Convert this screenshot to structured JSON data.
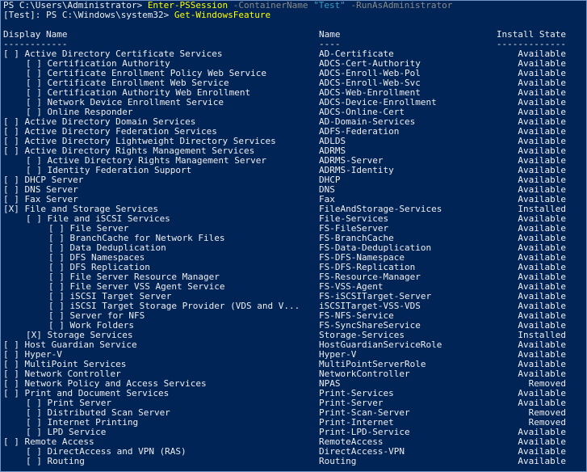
{
  "commands": [
    {
      "prompt": "PS C:\\Users\\Administrator> ",
      "cmdlet": "Enter-PSSession",
      "param1": " -ContainerName ",
      "value1": "\"Test\"",
      "param2": " -RunAsAdministrator"
    },
    {
      "prompt": "[Test]: PS C:\\Windows\\system32> ",
      "cmdlet": "Get-WindowsFeature"
    }
  ],
  "table": {
    "headers": {
      "display": "Display Name",
      "name": "Name",
      "state": "Install State"
    },
    "underline": {
      "display": "------------",
      "name": "----",
      "state": "-------------"
    },
    "rows": [
      {
        "level": 0,
        "display": "[ ] Active Directory Certificate Services",
        "name": "AD-Certificate",
        "state": "Available"
      },
      {
        "level": 1,
        "display": "[ ] Certification Authority",
        "name": "ADCS-Cert-Authority",
        "state": "Available"
      },
      {
        "level": 1,
        "display": "[ ] Certificate Enrollment Policy Web Service",
        "name": "ADCS-Enroll-Web-Pol",
        "state": "Available"
      },
      {
        "level": 1,
        "display": "[ ] Certificate Enrollment Web Service",
        "name": "ADCS-Enroll-Web-Svc",
        "state": "Available"
      },
      {
        "level": 1,
        "display": "[ ] Certification Authority Web Enrollment",
        "name": "ADCS-Web-Enrollment",
        "state": "Available"
      },
      {
        "level": 1,
        "display": "[ ] Network Device Enrollment Service",
        "name": "ADCS-Device-Enrollment",
        "state": "Available"
      },
      {
        "level": 1,
        "display": "[ ] Online Responder",
        "name": "ADCS-Online-Cert",
        "state": "Available"
      },
      {
        "level": 0,
        "display": "[ ] Active Directory Domain Services",
        "name": "AD-Domain-Services",
        "state": "Available"
      },
      {
        "level": 0,
        "display": "[ ] Active Directory Federation Services",
        "name": "ADFS-Federation",
        "state": "Available"
      },
      {
        "level": 0,
        "display": "[ ] Active Directory Lightweight Directory Services",
        "name": "ADLDS",
        "state": "Available"
      },
      {
        "level": 0,
        "display": "[ ] Active Directory Rights Management Services",
        "name": "ADRMS",
        "state": "Available"
      },
      {
        "level": 1,
        "display": "[ ] Active Directory Rights Management Server",
        "name": "ADRMS-Server",
        "state": "Available"
      },
      {
        "level": 1,
        "display": "[ ] Identity Federation Support",
        "name": "ADRMS-Identity",
        "state": "Available"
      },
      {
        "level": 0,
        "display": "[ ] DHCP Server",
        "name": "DHCP",
        "state": "Available"
      },
      {
        "level": 0,
        "display": "[ ] DNS Server",
        "name": "DNS",
        "state": "Available"
      },
      {
        "level": 0,
        "display": "[ ] Fax Server",
        "name": "Fax",
        "state": "Available"
      },
      {
        "level": 0,
        "display": "[X] File and Storage Services",
        "name": "FileAndStorage-Services",
        "state": "Installed"
      },
      {
        "level": 1,
        "display": "[ ] File and iSCSI Services",
        "name": "File-Services",
        "state": "Available"
      },
      {
        "level": 2,
        "display": "[ ] File Server",
        "name": "FS-FileServer",
        "state": "Available"
      },
      {
        "level": 2,
        "display": "[ ] BranchCache for Network Files",
        "name": "FS-BranchCache",
        "state": "Available"
      },
      {
        "level": 2,
        "display": "[ ] Data Deduplication",
        "name": "FS-Data-Deduplication",
        "state": "Available"
      },
      {
        "level": 2,
        "display": "[ ] DFS Namespaces",
        "name": "FS-DFS-Namespace",
        "state": "Available"
      },
      {
        "level": 2,
        "display": "[ ] DFS Replication",
        "name": "FS-DFS-Replication",
        "state": "Available"
      },
      {
        "level": 2,
        "display": "[ ] File Server Resource Manager",
        "name": "FS-Resource-Manager",
        "state": "Available"
      },
      {
        "level": 2,
        "display": "[ ] File Server VSS Agent Service",
        "name": "FS-VSS-Agent",
        "state": "Available"
      },
      {
        "level": 2,
        "display": "[ ] iSCSI Target Server",
        "name": "FS-iSCSITarget-Server",
        "state": "Available"
      },
      {
        "level": 2,
        "display": "[ ] iSCSI Target Storage Provider (VDS and V...",
        "name": "iSCSITarget-VSS-VDS",
        "state": "Available"
      },
      {
        "level": 2,
        "display": "[ ] Server for NFS",
        "name": "FS-NFS-Service",
        "state": "Available"
      },
      {
        "level": 2,
        "display": "[ ] Work Folders",
        "name": "FS-SyncShareService",
        "state": "Available"
      },
      {
        "level": 1,
        "display": "[X] Storage Services",
        "name": "Storage-Services",
        "state": "Installed"
      },
      {
        "level": 0,
        "display": "[ ] Host Guardian Service",
        "name": "HostGuardianServiceRole",
        "state": "Available"
      },
      {
        "level": 0,
        "display": "[ ] Hyper-V",
        "name": "Hyper-V",
        "state": "Available"
      },
      {
        "level": 0,
        "display": "[ ] MultiPoint Services",
        "name": "MultiPointServerRole",
        "state": "Available"
      },
      {
        "level": 0,
        "display": "[ ] Network Controller",
        "name": "NetworkController",
        "state": "Available"
      },
      {
        "level": 0,
        "display": "[ ] Network Policy and Access Services",
        "name": "NPAS",
        "state": "Removed"
      },
      {
        "level": 0,
        "display": "[ ] Print and Document Services",
        "name": "Print-Services",
        "state": "Available"
      },
      {
        "level": 1,
        "display": "[ ] Print Server",
        "name": "Print-Server",
        "state": "Available"
      },
      {
        "level": 1,
        "display": "[ ] Distributed Scan Server",
        "name": "Print-Scan-Server",
        "state": "Removed"
      },
      {
        "level": 1,
        "display": "[ ] Internet Printing",
        "name": "Print-Internet",
        "state": "Removed"
      },
      {
        "level": 1,
        "display": "[ ] LPD Service",
        "name": "Print-LPD-Service",
        "state": "Available"
      },
      {
        "level": 0,
        "display": "[ ] Remote Access",
        "name": "RemoteAccess",
        "state": "Available"
      },
      {
        "level": 1,
        "display": "[ ] DirectAccess and VPN (RAS)",
        "name": "DirectAccess-VPN",
        "state": "Available"
      },
      {
        "level": 1,
        "display": "[ ] Routing",
        "name": "Routing",
        "state": "Available"
      }
    ]
  },
  "colors": {
    "background": "#012456",
    "text": "#eeedf0",
    "cmdlet": "#ffff00",
    "parameter": "#8a8a8a",
    "string": "#2fa0c8"
  }
}
